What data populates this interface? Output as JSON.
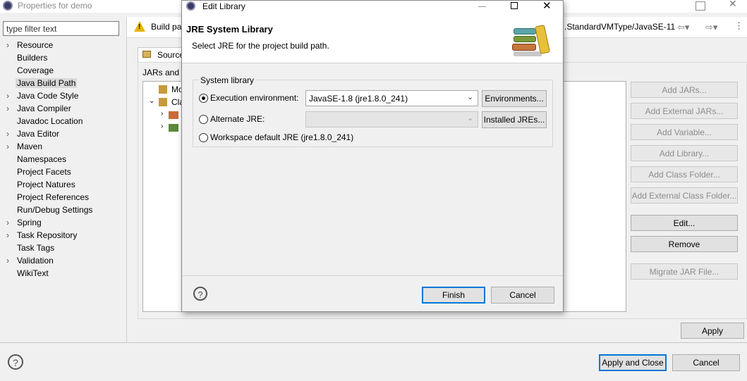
{
  "main_window": {
    "title": "Properties for demo",
    "filter_placeholder": "type filter text",
    "nav_items": [
      {
        "label": "Resource",
        "expandable": true
      },
      {
        "label": "Builders",
        "expandable": false
      },
      {
        "label": "Coverage",
        "expandable": false
      },
      {
        "label": "Java Build Path",
        "expandable": false,
        "selected": true
      },
      {
        "label": "Java Code Style",
        "expandable": true
      },
      {
        "label": "Java Compiler",
        "expandable": true
      },
      {
        "label": "Javadoc Location",
        "expandable": false
      },
      {
        "label": "Java Editor",
        "expandable": true
      },
      {
        "label": "Maven",
        "expandable": true
      },
      {
        "label": "Namespaces",
        "expandable": false
      },
      {
        "label": "Project Facets",
        "expandable": false
      },
      {
        "label": "Project Natures",
        "expandable": false
      },
      {
        "label": "Project References",
        "expandable": false
      },
      {
        "label": "Run/Debug Settings",
        "expandable": false
      },
      {
        "label": "Spring",
        "expandable": true
      },
      {
        "label": "Task Repository",
        "expandable": true
      },
      {
        "label": "Task Tags",
        "expandable": false
      },
      {
        "label": "Validation",
        "expandable": true
      },
      {
        "label": "WikiText",
        "expandable": false
      }
    ],
    "warning_text_left": "Build pa",
    "warning_text_right": ".StandardVMType/JavaSE-11",
    "tab_source": "Source",
    "jars_label": "JARs and c",
    "tree_items": [
      "Mo",
      "Cla"
    ],
    "side_buttons": [
      {
        "label": "Add JARs...",
        "enabled": false
      },
      {
        "label": "Add External JARs...",
        "enabled": false
      },
      {
        "label": "Add Variable...",
        "enabled": false
      },
      {
        "label": "Add Library...",
        "enabled": false
      },
      {
        "label": "Add Class Folder...",
        "enabled": false
      },
      {
        "label": "Add External Class Folder...",
        "enabled": false
      },
      {
        "label": "Edit...",
        "enabled": true
      },
      {
        "label": "Remove",
        "enabled": true
      },
      {
        "label": "Migrate JAR File...",
        "enabled": false
      }
    ],
    "apply_label": "Apply",
    "apply_close_label": "Apply and Close",
    "cancel_label": "Cancel"
  },
  "dialog": {
    "title": "Edit Library",
    "heading": "JRE System Library",
    "subtitle": "Select JRE for the project build path.",
    "group_label": "System library",
    "exec_env_label": "Execution environment:",
    "exec_env_value": "JavaSE-1.8 (jre1.8.0_241)",
    "environments_btn": "Environments...",
    "alt_jre_label": "Alternate JRE:",
    "alt_jre_value": "",
    "installed_jres_btn": "Installed JREs...",
    "workspace_label": "Workspace default JRE (jre1.8.0_241)",
    "finish_label": "Finish",
    "cancel_label": "Cancel"
  },
  "icons": {
    "app": "eclipse-icon",
    "warning": "warning-icon",
    "help": "help-icon",
    "banner": "library-books-icon"
  }
}
